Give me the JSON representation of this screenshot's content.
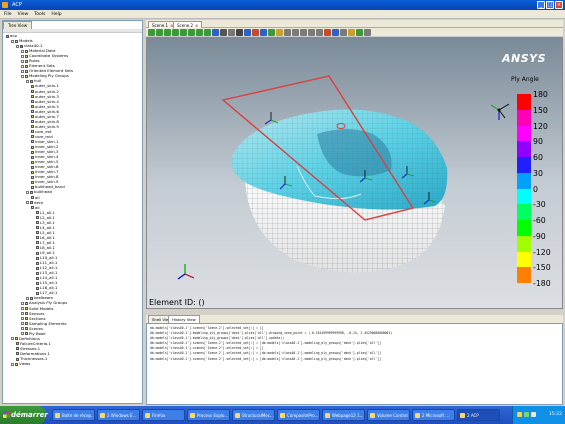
{
  "window": {
    "title": "ACP"
  },
  "menu": [
    "File",
    "View",
    "Tools",
    "Help"
  ],
  "tree": {
    "tab_label": "Tree View",
    "items": [
      {
        "label": "acp",
        "depth": 0,
        "icon": "db"
      },
      {
        "label": "Models",
        "depth": 1,
        "icon": "folder"
      },
      {
        "label": "class40.1",
        "depth": 2,
        "icon": "model"
      },
      {
        "label": "Material Data",
        "depth": 3,
        "icon": "folder"
      },
      {
        "label": "Coordinate Systems",
        "depth": 3,
        "icon": "folder"
      },
      {
        "label": "Rules",
        "depth": 3,
        "icon": "folder"
      },
      {
        "label": "Element Sets",
        "depth": 3,
        "icon": "folder"
      },
      {
        "label": "Oriented Element Sets",
        "depth": 3,
        "icon": "folder"
      },
      {
        "label": "Modeling Ply Groups",
        "depth": 3,
        "icon": "folder"
      },
      {
        "label": "hull",
        "depth": 4,
        "icon": "group"
      },
      {
        "label": "outer_skin.1",
        "depth": 5,
        "icon": "ply"
      },
      {
        "label": "outer_skin.2",
        "depth": 5,
        "icon": "ply"
      },
      {
        "label": "outer_skin.3",
        "depth": 5,
        "icon": "ply"
      },
      {
        "label": "outer_skin.4",
        "depth": 5,
        "icon": "ply"
      },
      {
        "label": "outer_skin.5",
        "depth": 5,
        "icon": "ply"
      },
      {
        "label": "outer_skin.6",
        "depth": 5,
        "icon": "ply"
      },
      {
        "label": "outer_skin.7",
        "depth": 5,
        "icon": "ply"
      },
      {
        "label": "outer_skin.8",
        "depth": 5,
        "icon": "ply"
      },
      {
        "label": "outer_skin.9",
        "depth": 5,
        "icon": "ply"
      },
      {
        "label": "core_ext",
        "depth": 5,
        "icon": "ply"
      },
      {
        "label": "core_mid",
        "depth": 5,
        "icon": "ply"
      },
      {
        "label": "inner_skin.1",
        "depth": 5,
        "icon": "ply"
      },
      {
        "label": "inner_skin.2",
        "depth": 5,
        "icon": "ply"
      },
      {
        "label": "inner_skin.3",
        "depth": 5,
        "icon": "ply"
      },
      {
        "label": "inner_skin.4",
        "depth": 5,
        "icon": "ply"
      },
      {
        "label": "inner_skin.5",
        "depth": 5,
        "icon": "ply"
      },
      {
        "label": "inner_skin.6",
        "depth": 5,
        "icon": "ply"
      },
      {
        "label": "inner_skin.7",
        "depth": 5,
        "icon": "ply"
      },
      {
        "label": "inner_skin.8",
        "depth": 5,
        "icon": "ply"
      },
      {
        "label": "inner_skin.9",
        "depth": 5,
        "icon": "ply"
      },
      {
        "label": "bulkhead_band",
        "depth": 5,
        "icon": "ply"
      },
      {
        "label": "bulkhead",
        "depth": 4,
        "icon": "group"
      },
      {
        "label": "all",
        "depth": 5,
        "icon": "ply"
      },
      {
        "label": "deck",
        "depth": 4,
        "icon": "group"
      },
      {
        "label": "all",
        "depth": 5,
        "icon": "ply"
      },
      {
        "label": "L1_all.1",
        "depth": 6,
        "icon": "ply"
      },
      {
        "label": "L2_all.1",
        "depth": 6,
        "icon": "ply"
      },
      {
        "label": "L3_all.1",
        "depth": 6,
        "icon": "ply"
      },
      {
        "label": "L4_all.1",
        "depth": 6,
        "icon": "ply"
      },
      {
        "label": "L5_all.1",
        "depth": 6,
        "icon": "ply"
      },
      {
        "label": "L6_all.1",
        "depth": 6,
        "icon": "ply"
      },
      {
        "label": "L7_all.1",
        "depth": 6,
        "icon": "ply"
      },
      {
        "label": "L8_all.1",
        "depth": 6,
        "icon": "ply"
      },
      {
        "label": "L9_all.1",
        "depth": 6,
        "icon": "ply"
      },
      {
        "label": "L10_all.1",
        "depth": 6,
        "icon": "ply"
      },
      {
        "label": "L11_all.1",
        "depth": 6,
        "icon": "ply"
      },
      {
        "label": "L12_all.1",
        "depth": 6,
        "icon": "ply"
      },
      {
        "label": "L13_all.1",
        "depth": 6,
        "icon": "ply"
      },
      {
        "label": "L14_all.1",
        "depth": 6,
        "icon": "ply"
      },
      {
        "label": "L15_all.1",
        "depth": 6,
        "icon": "ply"
      },
      {
        "label": "L16_all.1",
        "depth": 6,
        "icon": "ply"
      },
      {
        "label": "L17_all.1",
        "depth": 6,
        "icon": "ply"
      },
      {
        "label": "keelbeam",
        "depth": 4,
        "icon": "group"
      },
      {
        "label": "Analysis Ply Groups",
        "depth": 3,
        "icon": "folder"
      },
      {
        "label": "Solid Models",
        "depth": 3,
        "icon": "folder"
      },
      {
        "label": "Sensors",
        "depth": 3,
        "icon": "folder"
      },
      {
        "label": "Sections",
        "depth": 3,
        "icon": "folder"
      },
      {
        "label": "Sampling Elements",
        "depth": 3,
        "icon": "folder"
      },
      {
        "label": "Scenes",
        "depth": 3,
        "icon": "folder"
      },
      {
        "label": "Ply Book",
        "depth": 3,
        "icon": "folder"
      },
      {
        "label": "Definitions",
        "depth": 1,
        "icon": "folder"
      },
      {
        "label": "FailureCriteria.1",
        "depth": 2,
        "icon": "item"
      },
      {
        "label": "Stresses.1",
        "depth": 2,
        "icon": "item"
      },
      {
        "label": "Deformations.1",
        "depth": 2,
        "icon": "item"
      },
      {
        "label": "Thicknesses.1",
        "depth": 2,
        "icon": "item"
      },
      {
        "label": "Views",
        "depth": 1,
        "icon": "folder"
      }
    ]
  },
  "scene_tabs": [
    {
      "label": "Scene.1",
      "active": false
    },
    {
      "label": "Scene.2",
      "active": true
    }
  ],
  "viewport": {
    "logo": "ANSYS",
    "legend_title": "Ply Angle",
    "legend_values": [
      "180",
      "150",
      "120",
      "90",
      "60",
      "30",
      "0",
      "-30",
      "-60",
      "-90",
      "-120",
      "-150",
      "-180"
    ],
    "legend_colors": [
      "#ff0000",
      "#ff00b4",
      "#ff00ff",
      "#9000ff",
      "#2020ff",
      "#00a0ff",
      "#00ffff",
      "#00ff60",
      "#00ff00",
      "#a0ff00",
      "#ffff00",
      "#ff8000",
      "#ff0000"
    ],
    "element_id": "Element ID: ()"
  },
  "history": {
    "tabs": [
      {
        "label": "Shell View",
        "active": false
      },
      {
        "label": "History View",
        "active": true
      }
    ],
    "lines": [
      "db.models['class40.1'].scenes['Scene.2'].selected_set[:] = []",
      "db.models['class40.1'].modeling_ply_groups['deck'].plies['all'].draping_seed_point = (-0.181499999999998, -0.15, 2.45250000000001)",
      "db.models['class40.1'].modeling_ply_groups['deck'].plies['all'].update()",
      "db.models['class40.1'].scenes['Scene.2'].selected_set[:] = [db.models['class40.1'].modeling_ply_groups['deck'].plies['all']]",
      "db.models['class40.1'].scenes['Scene.2'].selected_set[:] = []",
      "db.models['class40.1'].scenes['Scene.2'].selected_set[:] = [db.models['class40.1'].modeling_ply_groups['deck'].plies['all']]",
      "db.models['class40.1'].scenes['Scene.2'].selected_set[:] = [db.models['class40.1'].modeling_ply_groups['deck'].plies['all']]"
    ]
  },
  "taskbar": {
    "start_label": "démarrer",
    "tasks": [
      "Boîte de récep...",
      "2 Windows E...",
      "Firefox",
      "Process Explo...",
      "StructuralMec...",
      "CompositePro...",
      "Webpage12 1...",
      "Volume Control",
      "2 Microsoft ...",
      "2 ACP"
    ],
    "clock": "15:22"
  }
}
